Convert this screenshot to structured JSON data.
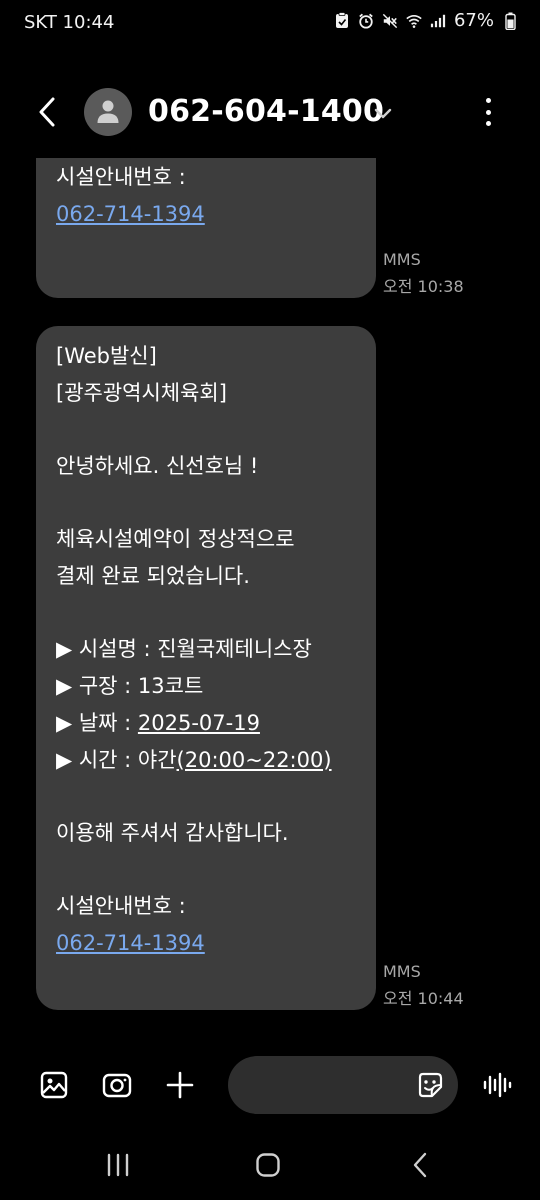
{
  "status_bar": {
    "carrier_time": "SKT 10:44",
    "battery": "67%"
  },
  "header": {
    "title": "062-604-1400"
  },
  "messages": [
    {
      "partial_top": true,
      "lines": [
        "시설안내번호 :"
      ],
      "link": "062-714-1394",
      "type": "MMS",
      "time": "오전 10:38"
    },
    {
      "tag": "[Web발신]",
      "org": "[광주광역시체육회]",
      "greeting": "안녕하세요. 신선호님 !",
      "body_1": "체육시설예약이 정상적으로",
      "body_2": "결제 완료 되었습니다.",
      "facility_label": "▶ 시설명 : ",
      "facility_value": "진월국제테니스장",
      "court_label": "▶ 구장 : ",
      "court_value": "13코트",
      "date_label": "▶ 날짜 : ",
      "date_value": "2025-07-19",
      "time_label": "▶ 시간 : 야간",
      "time_value": "(20:00~22:00)",
      "thanks": "이용해 주셔서 감사합니다.",
      "contact_label": "시설안내번호 :",
      "link": "062-714-1394",
      "type": "MMS",
      "time": "오전 10:44"
    }
  ],
  "icons": {
    "back": "back-arrow-icon",
    "avatar": "person-icon",
    "more": "more-vertical-icon",
    "gallery": "gallery-icon",
    "camera": "camera-icon",
    "add": "plus-icon",
    "sticker": "sticker-icon",
    "voice": "voice-wave-icon"
  },
  "colors": {
    "background": "#000000",
    "bubble": "#3d3d3d",
    "link": "#7aa9ee",
    "meta": "#a8a8a8"
  }
}
